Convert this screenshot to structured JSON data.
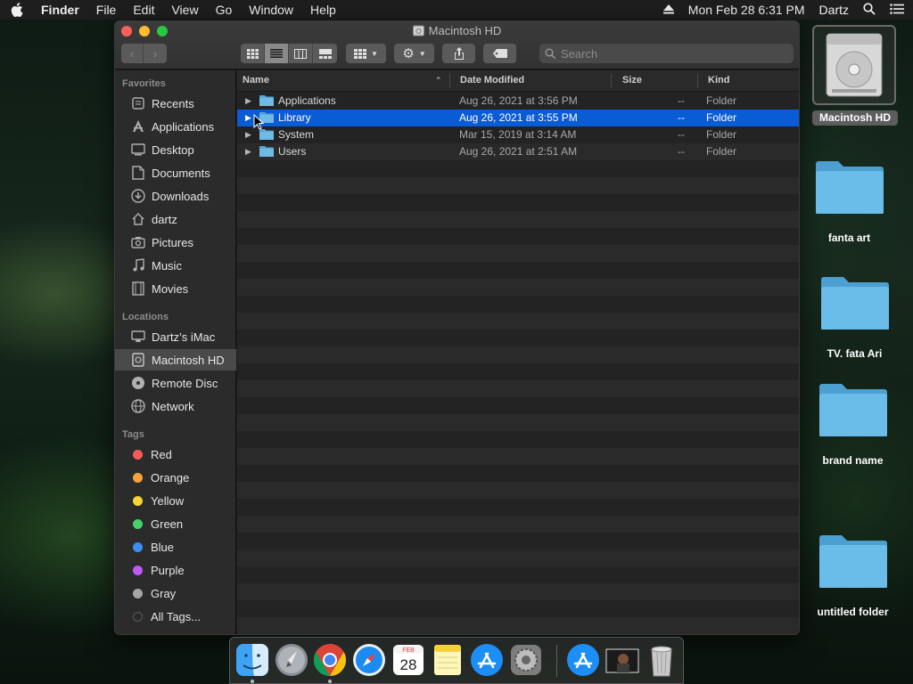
{
  "menubar": {
    "app": "Finder",
    "items": [
      "File",
      "Edit",
      "View",
      "Go",
      "Window",
      "Help"
    ],
    "datetime": "Mon Feb 28  6:31 PM",
    "user": "Dartz"
  },
  "window": {
    "title": "Macintosh HD",
    "search_placeholder": "Search"
  },
  "sidebar": {
    "favorites_header": "Favorites",
    "favorites": [
      {
        "label": "Recents",
        "icon": "clock-icon"
      },
      {
        "label": "Applications",
        "icon": "applications-icon"
      },
      {
        "label": "Desktop",
        "icon": "desktop-icon"
      },
      {
        "label": "Documents",
        "icon": "document-icon"
      },
      {
        "label": "Downloads",
        "icon": "download-icon"
      },
      {
        "label": "dartz",
        "icon": "home-icon"
      },
      {
        "label": "Pictures",
        "icon": "camera-icon"
      },
      {
        "label": "Music",
        "icon": "music-icon"
      },
      {
        "label": "Movies",
        "icon": "film-icon"
      }
    ],
    "locations_header": "Locations",
    "locations": [
      {
        "label": "Dartz’s iMac",
        "icon": "imac-icon"
      },
      {
        "label": "Macintosh HD",
        "icon": "disk-icon",
        "selected": true
      },
      {
        "label": "Remote Disc",
        "icon": "disc-icon"
      },
      {
        "label": "Network",
        "icon": "network-icon"
      }
    ],
    "tags_header": "Tags",
    "tags": [
      {
        "label": "Red",
        "color": "#fc5b57"
      },
      {
        "label": "Orange",
        "color": "#f7a23a"
      },
      {
        "label": "Yellow",
        "color": "#f5d433"
      },
      {
        "label": "Green",
        "color": "#47d16a"
      },
      {
        "label": "Blue",
        "color": "#3d8ff7"
      },
      {
        "label": "Purple",
        "color": "#bf5af2"
      },
      {
        "label": "Gray",
        "color": "#a6a6a6"
      },
      {
        "label": "All Tags...",
        "color": "#5a5a5a"
      }
    ]
  },
  "columns": {
    "name": "Name",
    "date": "Date Modified",
    "size": "Size",
    "kind": "Kind"
  },
  "files": [
    {
      "name": "Applications",
      "date": "Aug 26, 2021 at 3:56 PM",
      "size": "--",
      "kind": "Folder",
      "selected": false
    },
    {
      "name": "Library",
      "date": "Aug 26, 2021 at 3:55 PM",
      "size": "--",
      "kind": "Folder",
      "selected": true
    },
    {
      "name": "System",
      "date": "Mar 15, 2019 at 3:14 AM",
      "size": "--",
      "kind": "Folder",
      "selected": false
    },
    {
      "name": "Users",
      "date": "Aug 26, 2021 at 2:51 AM",
      "size": "--",
      "kind": "Folder",
      "selected": false
    }
  ],
  "desktop": {
    "hd_label": "Macintosh HD",
    "folders": [
      "fanta art",
      "TV. fata Ari",
      "brand name",
      "untitled folder"
    ]
  },
  "dock": {
    "calendar_month": "FEB",
    "calendar_day": "28"
  }
}
